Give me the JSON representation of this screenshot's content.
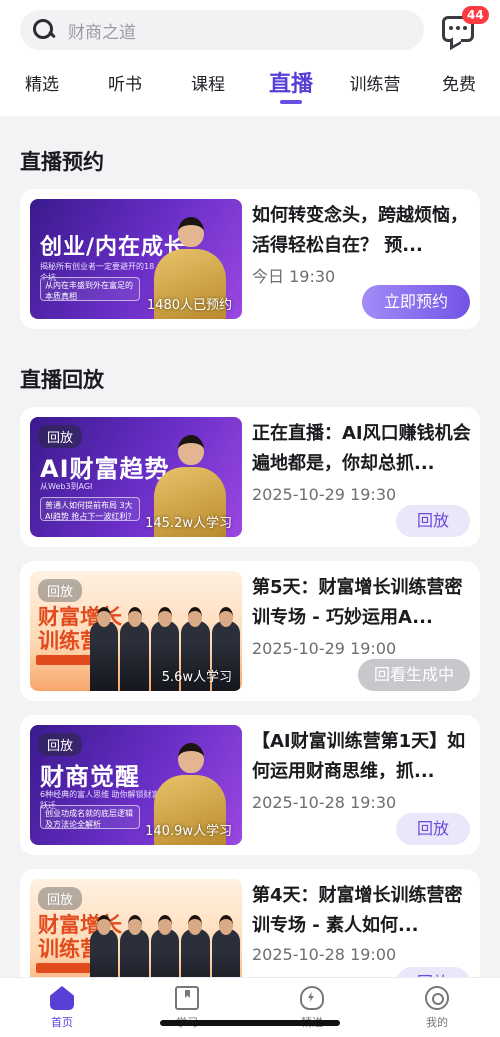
{
  "search": {
    "placeholder": "财商之道"
  },
  "header": {
    "message_badge": "44"
  },
  "tabs": [
    {
      "label": "精选"
    },
    {
      "label": "听书"
    },
    {
      "label": "课程"
    },
    {
      "label": "直播"
    },
    {
      "label": "训练营"
    },
    {
      "label": "免费"
    }
  ],
  "sections": {
    "reservation_title": "直播预约",
    "replay_title": "直播回放"
  },
  "reservation": {
    "title": "如何转变念头，跨越烦恼，活得轻松自在？ 预...",
    "date": "今日 19:30",
    "button": "立即预约",
    "thumb_title": "创业/内在成长",
    "thumb_sub": "揭秘所有创业者一定要避开的18个坑",
    "thumb_box": "从内在丰盛到外在富足的本质真相",
    "thumb_count": "1480人已预约"
  },
  "replays": [
    {
      "tag": "回放",
      "thumb_title": "AI财富趋势",
      "thumb_sub": "从Web3到AGI",
      "thumb_box": "普通人如何提前布局 3大AI趋势 抢占下一波红利?",
      "thumb_count": "145.2w人学习",
      "title": "正在直播：AI风口赚钱机会遍地都是，你却总抓...",
      "date": "2025-10-29 19:30",
      "button": "回放"
    },
    {
      "tag": "回放",
      "thumb_title": "财富增长训练营",
      "thumb_count": "5.6w人学习",
      "title": "第5天：财富增长训练营密训专场 - 巧妙运用A...",
      "date": "2025-10-29 19:00",
      "button": "回看生成中"
    },
    {
      "tag": "回放",
      "thumb_title": "财商觉醒",
      "thumb_sub": "6种经典的富人思维 助你解锁财富跃迁",
      "thumb_box": "创业功成名就的底层逻辑及方法论全解析",
      "thumb_count": "140.9w人学习",
      "title": "【AI财富训练营第1天】如何运用财商思维，抓...",
      "date": "2025-10-28 19:30",
      "button": "回放"
    },
    {
      "tag": "回放",
      "thumb_title": "财富增长训练营",
      "title": "第4天：财富增长训练营密训专场 - 素人如何...",
      "date": "2025-10-28 19:00",
      "button": "回放"
    }
  ],
  "bottom_nav": [
    {
      "label": "首页",
      "icon": "home-icon"
    },
    {
      "label": "学习",
      "icon": "book-icon"
    },
    {
      "label": "精进",
      "icon": "bulb-icon"
    },
    {
      "label": "我的",
      "icon": "profile-icon"
    }
  ],
  "colors": {
    "accent": "#5a3fd6",
    "badge": "#ff3b42"
  }
}
